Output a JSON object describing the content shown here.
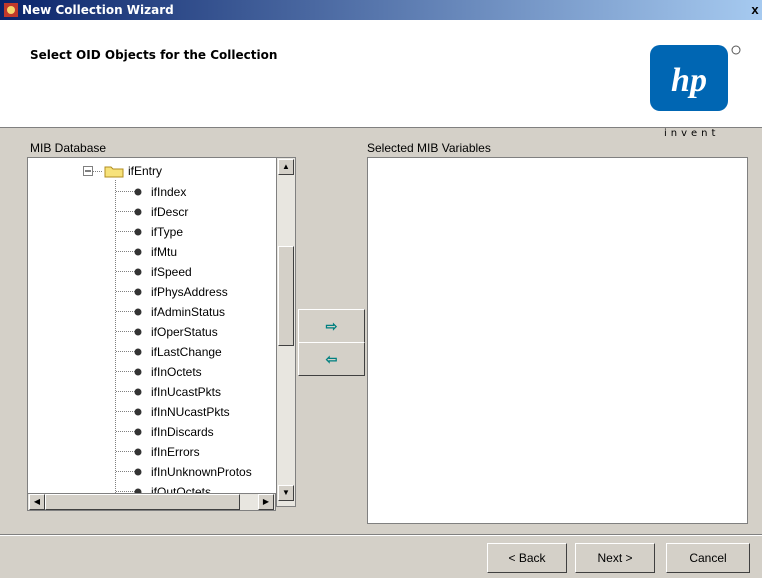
{
  "window": {
    "title": "New Collection Wizard",
    "close_label": "x"
  },
  "header": {
    "heading": "Select OID Objects for the Collection",
    "logo_tagline": "invent"
  },
  "left_panel": {
    "label": "MIB Database",
    "folder": "ifEntry",
    "items": [
      "ifIndex",
      "ifDescr",
      "ifType",
      "ifMtu",
      "ifSpeed",
      "ifPhysAddress",
      "ifAdminStatus",
      "ifOperStatus",
      "ifLastChange",
      "ifInOctets",
      "ifInUcastPkts",
      "ifInNUcastPkts",
      "ifInDiscards",
      "ifInErrors",
      "ifInUnknownProtos",
      "ifOutOctets"
    ]
  },
  "right_panel": {
    "label": "Selected MIB Variables"
  },
  "move_buttons": {
    "add_glyph": "⇨",
    "remove_glyph": "⇦"
  },
  "footer": {
    "back_label": "< Back",
    "next_label": "Next >",
    "cancel_label": "Cancel"
  },
  "colors": {
    "titlebar_start": "#0a246a",
    "titlebar_end": "#a6caf0",
    "logo_blue": "#0066b3",
    "arrow": "#008080"
  }
}
